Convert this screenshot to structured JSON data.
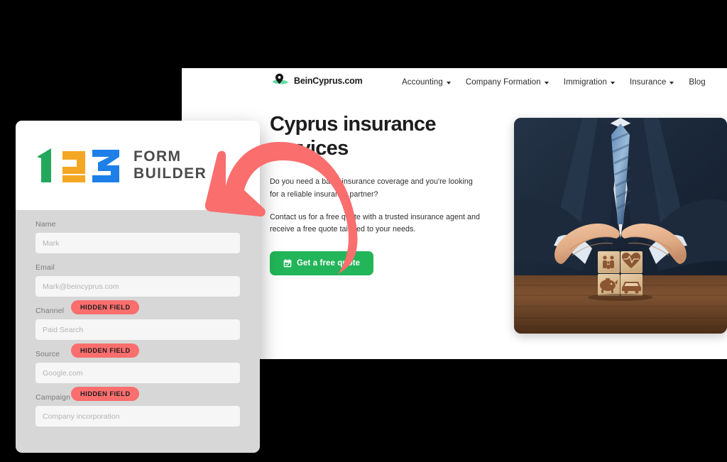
{
  "colors": {
    "accent_coral": "#fa6e6e",
    "cta_green": "#22b559",
    "logo_green": "#21a85c",
    "logo_orange": "#f5a623",
    "logo_blue": "#1e7fe8",
    "panel_gray": "#d7d7d7",
    "input_gray": "#f6f6f6",
    "text_dark": "#1d1d1f"
  },
  "website": {
    "brand": {
      "name": "BeinCyprus.com",
      "mark_icon": "cyprus-map-pin-icon"
    },
    "nav": [
      {
        "label": "Accounting",
        "has_dropdown": true
      },
      {
        "label": "Company Formation",
        "has_dropdown": true
      },
      {
        "label": "Immigration",
        "has_dropdown": true
      },
      {
        "label": "Insurance",
        "has_dropdown": true
      },
      {
        "label": "Blog",
        "has_dropdown": false
      }
    ],
    "hero": {
      "title": "Cyprus insurance services",
      "paragraph_1": "Do you need a basic insurance coverage and you're looking for a reliable insurance partner?",
      "paragraph_2": "Contact us for a free quote with a trusted insurance agent and receive a free quote tailored to your needs.",
      "cta_label": "Get a free quote",
      "cta_icon": "calendar-check-icon",
      "photo_alt": "businessman-hands-sheltering-wooden-insurance-blocks"
    }
  },
  "form_builder": {
    "logo": {
      "digits": "123",
      "word_line_1": "FORM",
      "word_line_2": "BUILDER"
    },
    "fields": [
      {
        "label": "Name",
        "placeholder": "Mark",
        "hidden_badge": null
      },
      {
        "label": "Email",
        "placeholder": "Mark@beincyprus.com",
        "hidden_badge": null
      },
      {
        "label": "Channel",
        "placeholder": "Paid Search",
        "hidden_badge": "HIDDEN FIELD"
      },
      {
        "label": "Source",
        "placeholder": "Google.com",
        "hidden_badge": "HIDDEN FIELD"
      },
      {
        "label": "Campaign",
        "placeholder": "Company incorporation",
        "hidden_badge": "HIDDEN FIELD"
      }
    ]
  },
  "annotation": {
    "arrow_icon": "curved-arrow-left-icon",
    "arrow_color": "#fa6e6e"
  }
}
